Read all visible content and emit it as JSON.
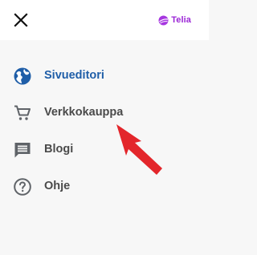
{
  "header": {
    "close_icon": "close-icon",
    "brand_logo": "telia-logo",
    "brand_text": "Telia"
  },
  "menu": {
    "items": [
      {
        "label": "Sivueditori",
        "icon": "globe-icon",
        "active": true
      },
      {
        "label": "Verkkokauppa",
        "icon": "cart-icon",
        "active": false
      },
      {
        "label": "Blogi",
        "icon": "comment-icon",
        "active": false
      },
      {
        "label": "Ohje",
        "icon": "help-icon",
        "active": false
      }
    ]
  },
  "colors": {
    "active": "#1f5ea8",
    "text": "#4a4a4a",
    "icon": "#5f6368",
    "brand": "#9b26d6",
    "annotation_arrow": "#e3262b"
  }
}
